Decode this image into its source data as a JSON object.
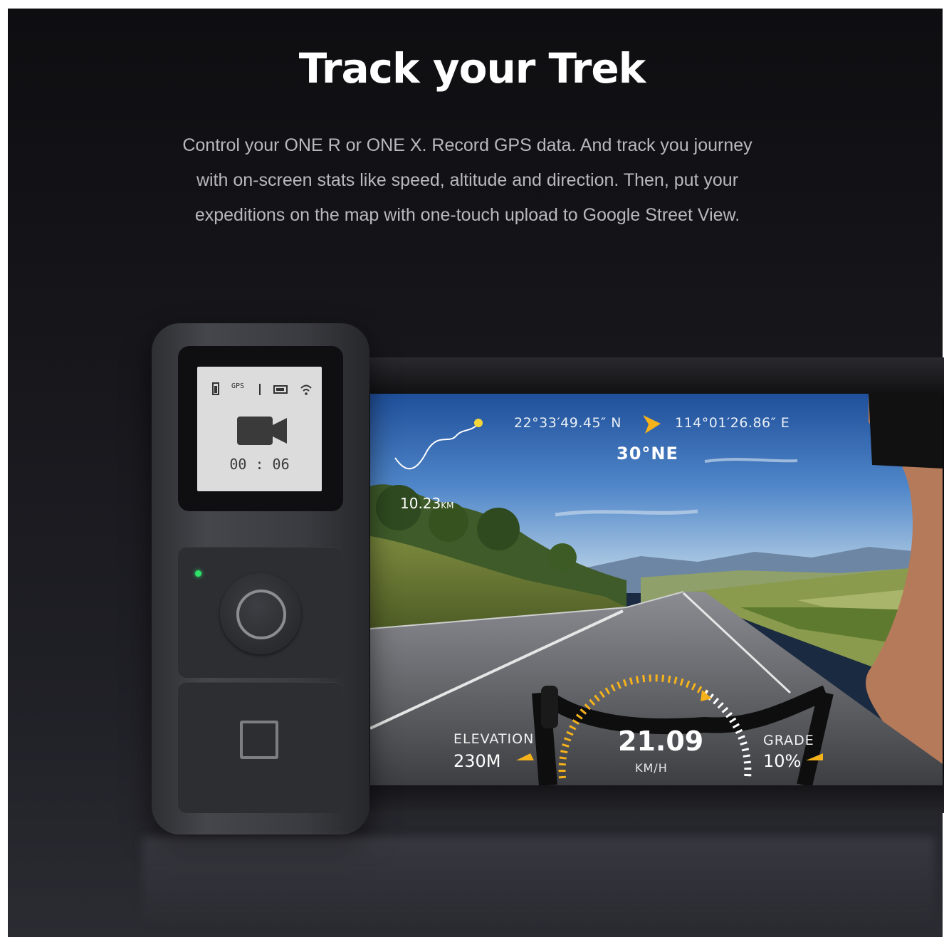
{
  "section": {
    "title": "Track your Trek",
    "description_lines": [
      "Control your ONE R or ONE X. Record GPS data. And track you journey",
      "with on-screen stats like speed, altitude and direction. Then, put your",
      "expeditions on the map with one-touch upload to Google Street View."
    ]
  },
  "remote": {
    "lcd_status_gps": "GPS",
    "lcd_timer": "00 : 06",
    "led_color": "#2ee26a"
  },
  "hud": {
    "latitude": "22°33′49.45″ N",
    "longitude": "114°01′26.86″ E",
    "heading": "30°NE",
    "distance_value": "10.23",
    "distance_unit": "KM",
    "elevation_label": "ELEVATION",
    "elevation_value": "230M",
    "speed_value": "21.09",
    "speed_unit": "KM/H",
    "grade_label": "GRADE",
    "grade_value": "10%",
    "accent_color": "#f5b21b"
  }
}
